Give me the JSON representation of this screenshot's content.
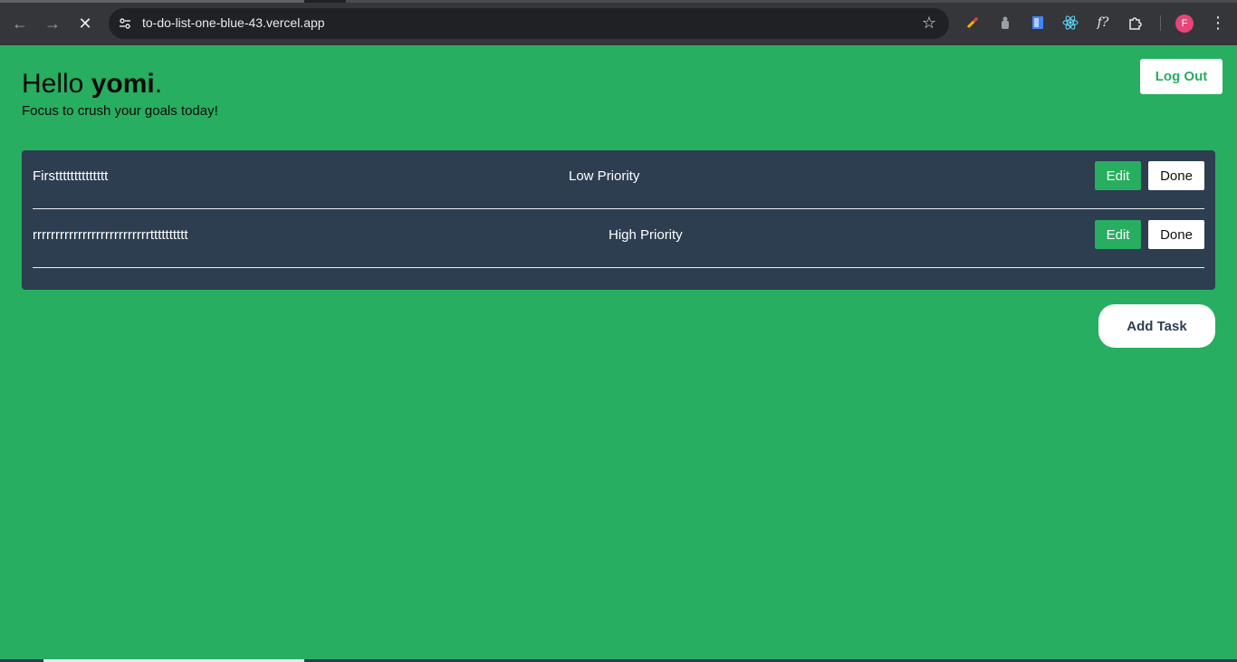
{
  "browser": {
    "url": "to-do-list-one-blue-43.vercel.app",
    "profile_initial": "F"
  },
  "page": {
    "greeting_prefix": "Hello ",
    "user_name": "yomi",
    "greeting_suffix": ".",
    "subtitle": "Focus to crush your goals today!",
    "logout_label": "Log Out",
    "add_task_label": "Add Task"
  },
  "tasks": [
    {
      "title": "Firstttttttttttttt",
      "priority": "Low Priority",
      "edit_label": "Edit",
      "done_label": "Done"
    },
    {
      "title": "rrrrrrrrrrrrrrrrrrrrrrrrrrtttttttttt",
      "priority": "High Priority",
      "edit_label": "Edit",
      "done_label": "Done"
    }
  ],
  "colors": {
    "background": "#27ae60",
    "panel": "#2c3e50",
    "accent": "#27ae60"
  }
}
